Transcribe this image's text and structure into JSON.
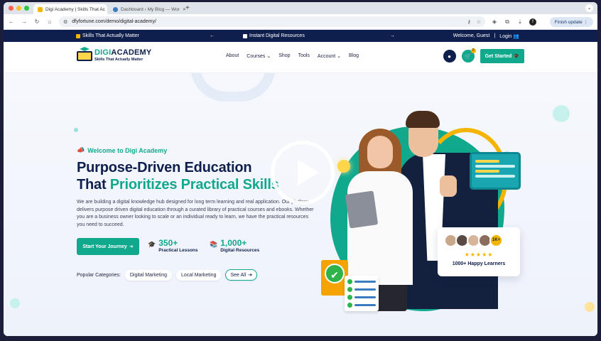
{
  "browser": {
    "tabs": [
      {
        "title": "Digi Academy | Skills That Ac",
        "active": true
      },
      {
        "title": "Dashboard ‹ My Blog — Wor",
        "active": false
      }
    ],
    "new_tab": "+",
    "url": "dfyfortune.com/demo/digital-academy/",
    "update_label": "Finish update",
    "profile_initial": "f",
    "colors": {
      "close": "#ff5f57",
      "minimize": "#febc2e",
      "zoom": "#28c840"
    }
  },
  "topbar": {
    "left_text": "Skills That Actually Matter",
    "center_text": "Instant Digital Resources",
    "prev_arrow": "←",
    "next_arrow": "→",
    "welcome": "Welcome, Guest",
    "login": "Login"
  },
  "header": {
    "logo_name_part1": "DIGI",
    "logo_name_part2": "ACADEMY",
    "logo_tagline": "Skills That Actually Matter",
    "nav": [
      "About",
      "Courses",
      "Shop",
      "Tools",
      "Account",
      "Blog"
    ],
    "cart_count": "0",
    "cta": "Get Started"
  },
  "hero": {
    "eyebrow": "Welcome to Digi Academy",
    "headline_line1": "Purpose-Driven Education",
    "headline_line2_plain": "That ",
    "headline_line2_accent": "Prioritizes Practical Skills",
    "description": "We are building a digital knowledge hub designed for long term learning and real application. Our platform delivers purpose driven digital education through a curated library of practical courses and ebooks. Whether you are a business owner looking to scale or an individual ready to learn, we have the practical resources you need to succeed.",
    "journey_button": "Start Your Journey",
    "stats": [
      {
        "number": "350+",
        "label": "Practical Lessons"
      },
      {
        "number": "1,000+",
        "label": "Digital Resources"
      }
    ],
    "popular_label": "Popular Categories:",
    "categories": [
      "Digital Marketing",
      "Local Marketing"
    ],
    "see_all": "See All",
    "learners_badge": "1K+",
    "learners_stars": "★★★★★",
    "learners_label": "1000+ Happy Learners"
  },
  "colors": {
    "navy": "#0f1f4d",
    "teal": "#11a98e",
    "yellow": "#f5b400"
  }
}
